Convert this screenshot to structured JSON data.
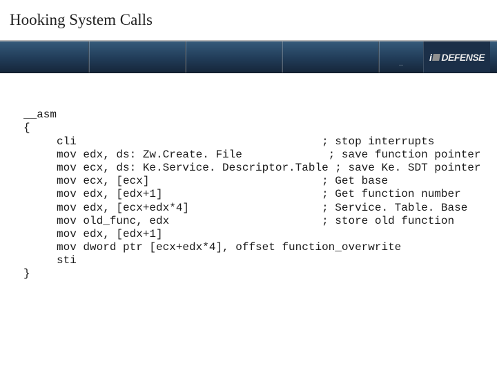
{
  "title": "Hooking System Calls",
  "logo_text_lead": "i",
  "logo_text_rest": "DEFENSE",
  "ribbon_dots": "…",
  "code": {
    "l0": "__asm",
    "l1": "{",
    "l2": "cli                                     ; stop interrupts",
    "l3": "mov edx, ds: Zw.Create. File             ; save function pointer",
    "l4": "mov ecx, ds: Ke.Service. Descriptor.Table ; save Ke. SDT pointer",
    "l5": "mov ecx, [ecx]                          ; Get base",
    "l6": "mov edx, [edx+1]                        ; Get function number",
    "l7": "mov edx, [ecx+edx*4]                    ; Service. Table. Base",
    "l8": "mov old_func, edx                       ; store old function",
    "l9": "mov edx, [edx+1]",
    "l10": "mov dword ptr [ecx+edx*4], offset function_overwrite",
    "l11": "sti",
    "l12": "}"
  }
}
